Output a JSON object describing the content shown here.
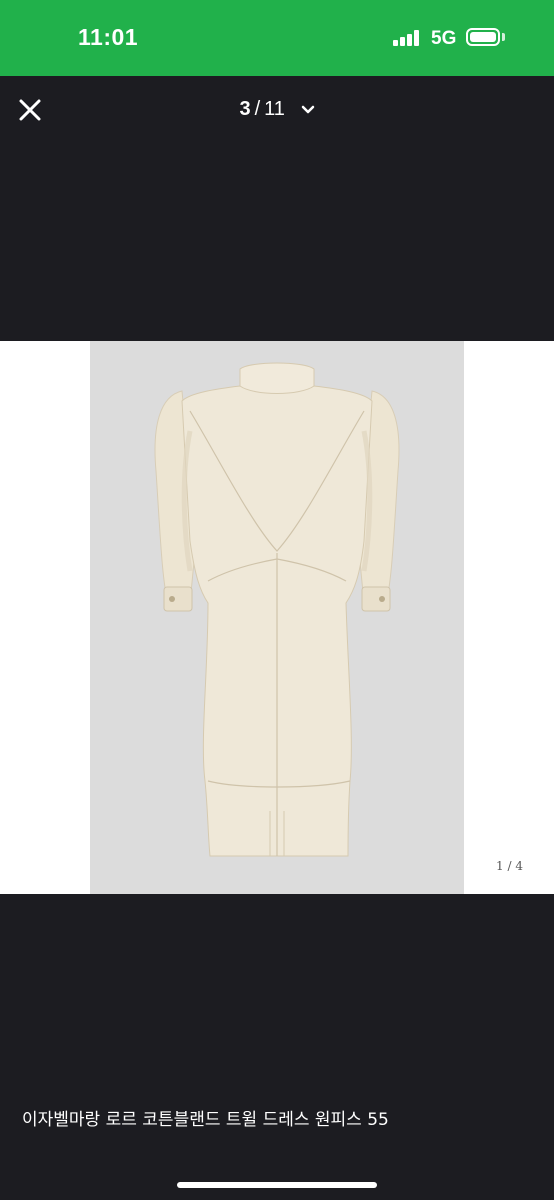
{
  "status_bar": {
    "time": "11:01",
    "network": "5G",
    "signal_bars": 4,
    "battery_level": 1.0,
    "color": "#21b14b"
  },
  "header": {
    "current": "3",
    "separator": "/",
    "total": "11",
    "close_icon": "close-icon",
    "dropdown_icon": "chevron-down-icon"
  },
  "photo": {
    "description_icon": "dress-photo",
    "slide_current": "1",
    "slide_separator": "/",
    "slide_total": "4"
  },
  "caption": "이자벨마랑 로르 코튼블랜드 트윌 드레스 원피스 55",
  "colors": {
    "background": "#1c1c21",
    "dress": "#efe8d8"
  }
}
